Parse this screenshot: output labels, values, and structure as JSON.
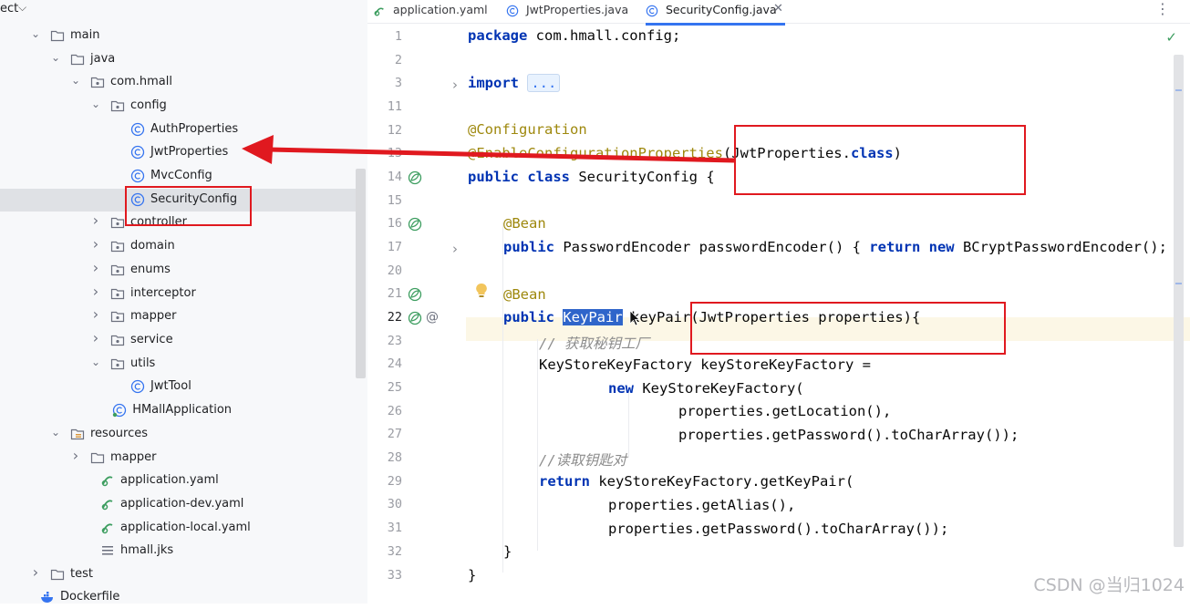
{
  "sidebar": {
    "project_label": "ect",
    "items": [
      {
        "label": "main",
        "type": "folder"
      },
      {
        "label": "java",
        "type": "folder"
      },
      {
        "label": "com.hmall",
        "type": "package"
      },
      {
        "label": "config",
        "type": "package"
      },
      {
        "label": "AuthProperties",
        "type": "class"
      },
      {
        "label": "JwtProperties",
        "type": "class"
      },
      {
        "label": "MvcConfig",
        "type": "class"
      },
      {
        "label": "SecurityConfig",
        "type": "class"
      },
      {
        "label": "controller",
        "type": "package"
      },
      {
        "label": "domain",
        "type": "package"
      },
      {
        "label": "enums",
        "type": "package"
      },
      {
        "label": "interceptor",
        "type": "package"
      },
      {
        "label": "mapper",
        "type": "package"
      },
      {
        "label": "service",
        "type": "package"
      },
      {
        "label": "utils",
        "type": "package"
      },
      {
        "label": "JwtTool",
        "type": "class"
      },
      {
        "label": "HMallApplication",
        "type": "app-class"
      },
      {
        "label": "resources",
        "type": "res-folder"
      },
      {
        "label": "mapper",
        "type": "folder"
      },
      {
        "label": "application.yaml",
        "type": "yaml"
      },
      {
        "label": "application-dev.yaml",
        "type": "yaml"
      },
      {
        "label": "application-local.yaml",
        "type": "yaml"
      },
      {
        "label": "hmall.jks",
        "type": "text"
      },
      {
        "label": "test",
        "type": "folder"
      },
      {
        "label": "Dockerfile",
        "type": "docker"
      }
    ]
  },
  "tabs": [
    {
      "label": "application.yaml",
      "icon": "yaml-icon"
    },
    {
      "label": "JwtProperties.java",
      "icon": "class-icon"
    },
    {
      "label": "SecurityConfig.java",
      "icon": "class-icon",
      "active": true
    }
  ],
  "editor": {
    "line_numbers": [
      "1",
      "2",
      "3",
      "11",
      "12",
      "13",
      "14",
      "15",
      "16",
      "17",
      "20",
      "21",
      "22",
      "23",
      "24",
      "25",
      "26",
      "27",
      "28",
      "29",
      "30",
      "31",
      "32",
      "33"
    ],
    "current_line": "22",
    "code": {
      "l1_kw": "package",
      "l1_rest": " com.hmall.config;",
      "l3_kw": "import",
      "l3_dots": "...",
      "l12": "@Configuration",
      "l13_ann": "@EnableConfigurationProperties",
      "l13_rest": "(JwtProperties.",
      "l13_kw": "class",
      "l13_end": ")",
      "l14_kw1": "public",
      "l14_kw2": "class",
      "l14_rest": " SecurityConfig {",
      "l16": "@Bean",
      "l17_kw1": "public",
      "l17_mid": " PasswordEncoder passwordEncoder() { ",
      "l17_kw2": "return",
      "l17_kw3": "new",
      "l17_end": " BCryptPasswordEncoder();",
      "l21": "@Bean",
      "l22_kw": "public",
      "l22_sel": "KeyPair",
      "l22_rest": " keyPair(JwtProperties properties){",
      "l23": "// 获取秘钥工厂",
      "l24": "KeyStoreKeyFactory keyStoreKeyFactory =",
      "l25_kw": "new",
      "l25_rest": " KeyStoreKeyFactory(",
      "l26": "properties.getLocation(),",
      "l27": "properties.getPassword().toCharArray());",
      "l28": "//读取钥匙对",
      "l29_kw": "return",
      "l29_rest": " keyStoreKeyFactory.getKeyPair(",
      "l30": "properties.getAlias(),",
      "l31": "properties.getPassword().toCharArray());",
      "l32": "}",
      "l33": "}"
    }
  },
  "watermark": "CSDN @当归1024",
  "colors": {
    "annotation_red": "#e0191f",
    "keyword": "#0033b3",
    "annotation": "#9e880d",
    "accent": "#3574f0"
  }
}
